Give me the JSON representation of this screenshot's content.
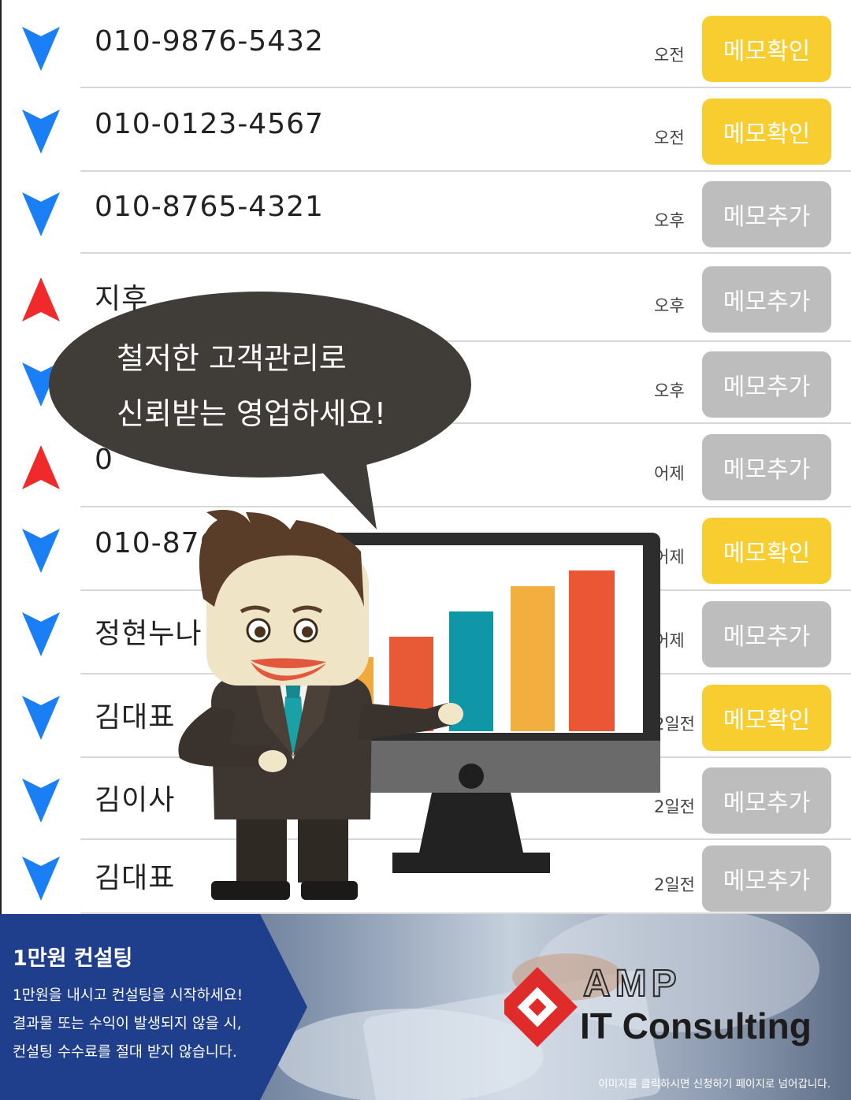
{
  "rows": [
    {
      "name": "010-9876-5432",
      "time": "오전",
      "memo": "메모확인",
      "memo_state": "confirmed",
      "direction": "down"
    },
    {
      "name": "010-0123-4567",
      "time": "오전",
      "memo": "메모확인",
      "memo_state": "confirmed",
      "direction": "down"
    },
    {
      "name": "010-8765-4321",
      "time": "오후",
      "memo": "메모추가",
      "memo_state": "add",
      "direction": "down"
    },
    {
      "name": "지후",
      "time": "오후",
      "memo": "메모추가",
      "memo_state": "add",
      "direction": "up"
    },
    {
      "name": "",
      "time": "오후",
      "memo": "메모추가",
      "memo_state": "add",
      "direction": "down"
    },
    {
      "name": "0",
      "time": "어제",
      "memo": "메모추가",
      "memo_state": "add",
      "direction": "up"
    },
    {
      "name": "010-876",
      "time": "어제",
      "memo": "메모확인",
      "memo_state": "confirmed",
      "direction": "down"
    },
    {
      "name": "정현누나",
      "time": "어제",
      "memo": "메모추가",
      "memo_state": "add",
      "direction": "down"
    },
    {
      "name": "김대표",
      "time": "2일전",
      "memo": "메모확인",
      "memo_state": "confirmed",
      "direction": "down"
    },
    {
      "name": "김이사",
      "time": "2일전",
      "memo": "메모추가",
      "memo_state": "add",
      "direction": "down"
    },
    {
      "name": "김대표",
      "time": "2일전",
      "memo": "메모추가",
      "memo_state": "add",
      "direction": "down"
    }
  ],
  "speech_bubble": {
    "line1": "철저한 고객관리로",
    "line2": "신뢰받는 영업하세요!"
  },
  "footer": {
    "title": "1만원 컨설팅",
    "desc_line1": "1만원을 내시고 컨설팅을 시작하세요!",
    "desc_line2": "결과물 또는 수익이 발생되지 않을 시,",
    "desc_line3": "컨설팅 수수료를 절대 받지 않습니다.",
    "logo_line1": "AMP",
    "logo_line2": "IT Consulting",
    "note": "이미지를 클릭하시면 신청하기 페이지로 넘어갑니다."
  },
  "colors": {
    "arrow_down": "#1a7ff5",
    "arrow_up": "#f02a2a",
    "memo_confirmed": "#f7cd2f",
    "memo_add": "#bdbdbd",
    "footer_panel": "#1f3f8c",
    "logo_red": "#e02b2b"
  }
}
